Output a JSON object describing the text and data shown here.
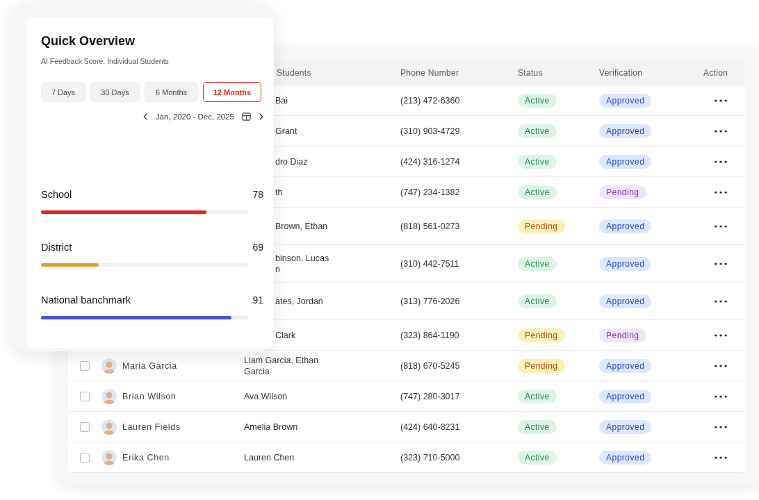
{
  "overview": {
    "title": "Quick Overview",
    "subtitle": "AI Feedback Score, Individual Students",
    "ranges": [
      {
        "label": "7 Days",
        "selected": false
      },
      {
        "label": "30 Days",
        "selected": false
      },
      {
        "label": "6 Months",
        "selected": false
      },
      {
        "label": "12 Months",
        "selected": true
      }
    ],
    "period": "Jan, 2020 - Dec, 2025",
    "metrics": [
      {
        "label": "School",
        "value": "78",
        "level": 0.8,
        "color": "#e3261c"
      },
      {
        "label": "District",
        "value": "69",
        "level": 0.28,
        "color": "#e0a030"
      },
      {
        "label": "National banchmark",
        "value": "91",
        "level": 0.92,
        "color": "#4a55d8"
      }
    ]
  },
  "table": {
    "columns": [
      "Students",
      "Phone Number",
      "Status",
      "Verification",
      "Action"
    ],
    "rows": [
      {
        "students": "Bai",
        "phone": "(213) 472-6360",
        "status": {
          "label": "Active",
          "kind": "active"
        },
        "verification": {
          "label": "Approved",
          "kind": "approved"
        }
      },
      {
        "students": "Grant",
        "phone": "(310) 903-4729",
        "status": {
          "label": "Active",
          "kind": "active"
        },
        "verification": {
          "label": "Approved",
          "kind": "approved"
        }
      },
      {
        "students": "dro Diaz",
        "phone": "(424) 316-1274",
        "status": {
          "label": "Active",
          "kind": "active"
        },
        "verification": {
          "label": "Approved",
          "kind": "approved"
        }
      },
      {
        "students": "th",
        "phone": "(747) 234-1382",
        "status": {
          "label": "Active",
          "kind": "active"
        },
        "verification": {
          "label": "Pending",
          "kind": "pending"
        }
      },
      {
        "students": "Brown, Ethan",
        "phone": "(818) 561-0273",
        "tall": true,
        "status": {
          "label": "Pending",
          "kind": "pending"
        },
        "verification": {
          "label": "Approved",
          "kind": "approved"
        }
      },
      {
        "students": "binson, Lucas\nn",
        "phone": "(310) 442-7511",
        "tall": true,
        "status": {
          "label": "Active",
          "kind": "active"
        },
        "verification": {
          "label": "Approved",
          "kind": "approved"
        }
      },
      {
        "students": "ates, Jordan",
        "phone": "(313) 776-2026",
        "tall": true,
        "status": {
          "label": "Active",
          "kind": "active"
        },
        "verification": {
          "label": "Approved",
          "kind": "approved"
        }
      },
      {
        "students": "Clark",
        "phone": "(323) 864-1190",
        "status": {
          "label": "Pending",
          "kind": "pending"
        },
        "verification": {
          "label": "Pending",
          "kind": "pending"
        }
      },
      {
        "checked": false,
        "name": "Maria Garcia",
        "students": "Liam Garcia, Ethan\nGarcia",
        "phone": "(818) 670-5245",
        "status": {
          "label": "Pending",
          "kind": "pending"
        },
        "verification": {
          "label": "Approved",
          "kind": "approved"
        }
      },
      {
        "checked": false,
        "name": "Brian Wilson",
        "students": "Ava Wilson",
        "phone": "(747) 280-3017",
        "status": {
          "label": "Active",
          "kind": "active"
        },
        "verification": {
          "label": "Approved",
          "kind": "approved"
        }
      },
      {
        "checked": false,
        "name": "Lauren Fields",
        "students": "Amelia Brown",
        "phone": "(424) 640-8231",
        "status": {
          "label": "Active",
          "kind": "active"
        },
        "verification": {
          "label": "Approved",
          "kind": "approved"
        }
      },
      {
        "checked": false,
        "name": "Erika Chen",
        "students": "Lauren Chen",
        "phone": "(323) 710-5000",
        "status": {
          "label": "Active",
          "kind": "active"
        },
        "verification": {
          "label": "Approved",
          "kind": "approved"
        }
      }
    ]
  }
}
